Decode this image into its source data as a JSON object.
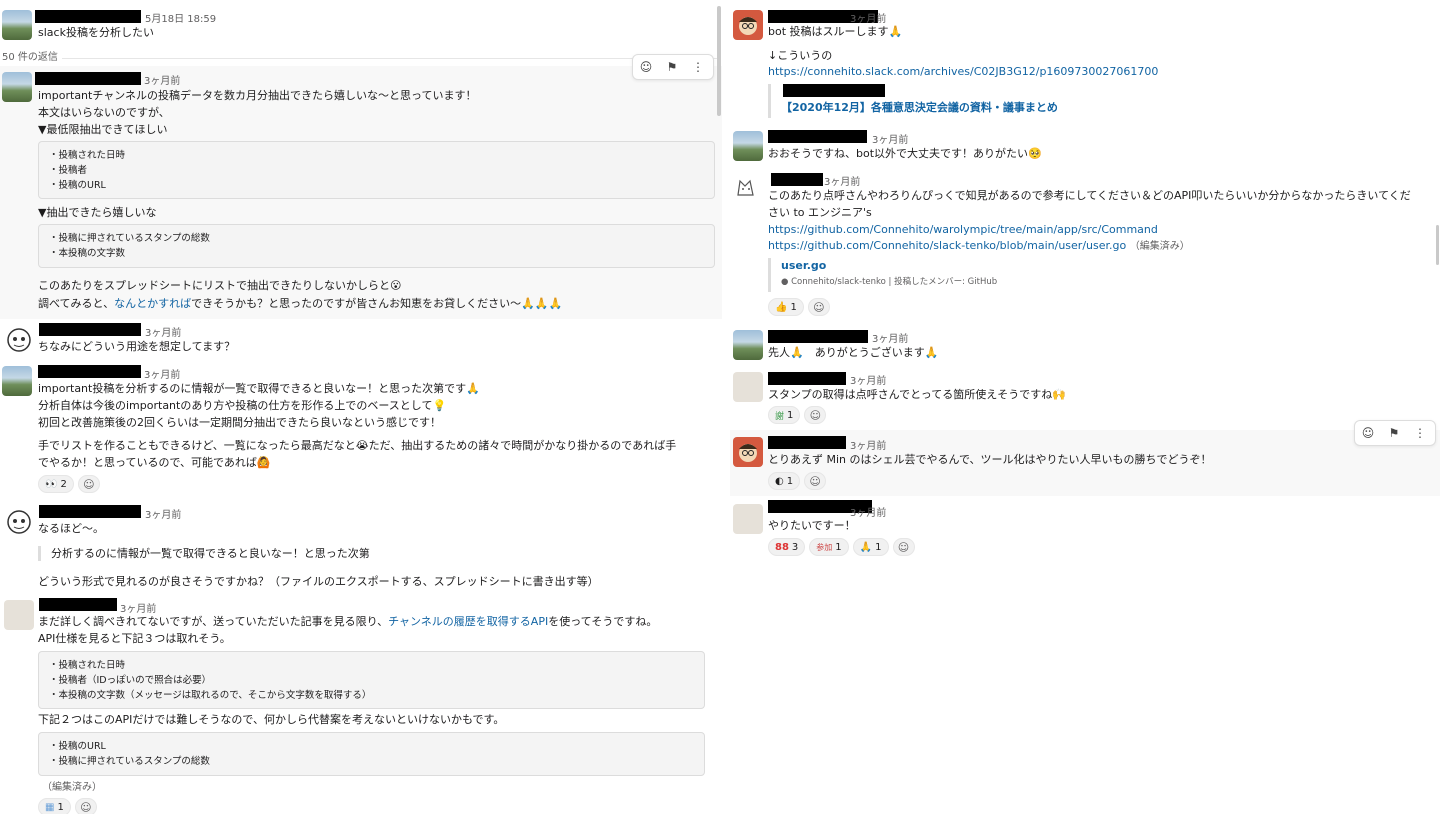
{
  "left": {
    "parent": {
      "time": "5月18日 18:59",
      "text": "slack投稿を分析したい"
    },
    "reply_count": "50 件の返信",
    "m1": {
      "time": "3ヶ月前",
      "l1": "importantチャンネルの投稿データを数カ月分抽出できたら嬉しいな〜と思っています！",
      "l2": "本文はいらないのですが、",
      "l3": "▼最低限抽出できてほしい",
      "code1": [
        "・投稿された日時",
        "・投稿者",
        "・投稿のURL"
      ],
      "l4": "▼抽出できたら嬉しいな",
      "code2": [
        "・投稿に押されているスタンプの総数",
        "・本投稿の文字数"
      ],
      "l5": "このあたりをスプレッドシートにリストで抽出できたりしないかしらと😮",
      "l6a": "調べてみると、",
      "l6link": "なんとかすれば",
      "l6b": "できそうかも？と思ったのですが皆さんお知恵をお貸しください〜🙏🙏🙏"
    },
    "m2": {
      "time": "3ヶ月前",
      "text": "ちなみにどういう用途を想定してます？"
    },
    "m3": {
      "time": "3ヶ月前",
      "l1": "important投稿を分析するのに情報が一覧で取得できると良いなー！と思った次第です🙏",
      "l2": "分析自体は今後のimportantのあり方や投稿の仕方を形作る上でのベースとして💡",
      "l3": "初回と改善施策後の2回くらいは一定期間分抽出できたら良いなという感じです！",
      "l4": "手でリストを作ることもできるけど、一覧になったら最高だなと😭ただ、抽出するための諸々で時間がかなり掛かるのであれば手",
      "l5": "でやるか！と思っているので、可能であれば🙆",
      "react": "👀",
      "react_count": "2"
    },
    "m4": {
      "time": "3ヶ月前",
      "text": "なるほど〜。",
      "quote": "分析するのに情報が一覧で取得できると良いなー！と思った次第",
      "l2": "どういう形式で見れるのが良さそうですかね？（ファイルのエクスポートする、スプレッドシートに書き出す等）"
    },
    "m5": {
      "time": "3ヶ月前",
      "l1a": "まだ詳しく調べきれてないですが、送っていただいた記事を見る限り、",
      "l1link": "チャンネルの履歴を取得するAPI",
      "l1b": "を使ってそうですね。",
      "l2": "API仕様を見ると下記３つは取れそう。",
      "code1": [
        "・投稿された日時",
        "・投稿者（IDっぽいので照合は必要）",
        "・本投稿の文字数（メッセージは取れるので、そこから文字数を取得する）"
      ],
      "l3": "下記２つはこのAPIだけでは難しそうなので、何かしら代替案を考えないといけないかもです。",
      "code2": [
        "・投稿のURL",
        "・投稿に押されているスタンプの総数"
      ],
      "edited": "（編集済み）",
      "react_count": "1"
    }
  },
  "right": {
    "r1": {
      "time": "3ヶ月前",
      "l1": "bot 投稿はスルーします🙏",
      "l2": "↓こういうの",
      "url": "https://connehito.slack.com/archives/C02JB3G12/p1609730027061700",
      "unfurl": "【2020年12月】各種意思決定会議の資料・議事まとめ"
    },
    "r2": {
      "time": "3ヶ月前",
      "text": "おおそうですね、bot以外で大丈夫です！ありがたい🥺"
    },
    "r3": {
      "time": "3ヶ月前",
      "l1": "このあたり点呼さんやわろりんぴっくで知見があるので参考にしてください＆どのAPI叩いたらいいか分からなかったらきいてくだ",
      "l2": "さい to エンジニア's",
      "url1": "https://github.com/Connehito/warolympic/tree/main/app/src/Command",
      "url2": "https://github.com/Connehito/slack-tenko/blob/main/user/user.go",
      "edited": "（編集済み）",
      "unfurl_title": "user.go",
      "unfurl_meta": "Connehito/slack-tenko | 投稿したメンバー: GitHub",
      "react": "👍",
      "react_count": "1"
    },
    "r4": {
      "time": "3ヶ月前",
      "text": "先人🙏　ありがとうございます🙏"
    },
    "r5": {
      "time": "3ヶ月前",
      "text": "スタンプの取得は点呼さんでとってる箇所使えそうですね🙌",
      "react": "謝",
      "react_count": "1"
    },
    "r6": {
      "time": "3ヶ月前",
      "text": "とりあえず Min のはシェル芸でやるんで、ツール化はやりたい人早いもの勝ちでどうぞ！",
      "react_count": "1"
    },
    "r7": {
      "time": "3ヶ月前",
      "text": "やりたいですー！",
      "reacts": [
        {
          "icon": "88",
          "count": "3"
        },
        {
          "icon": "参加",
          "count": "1"
        },
        {
          "icon": "🙏",
          "count": "1"
        }
      ]
    }
  },
  "icons": {
    "add_reaction": "add-reaction-icon",
    "bookmark": "bookmark-icon",
    "more": "more-icon"
  }
}
